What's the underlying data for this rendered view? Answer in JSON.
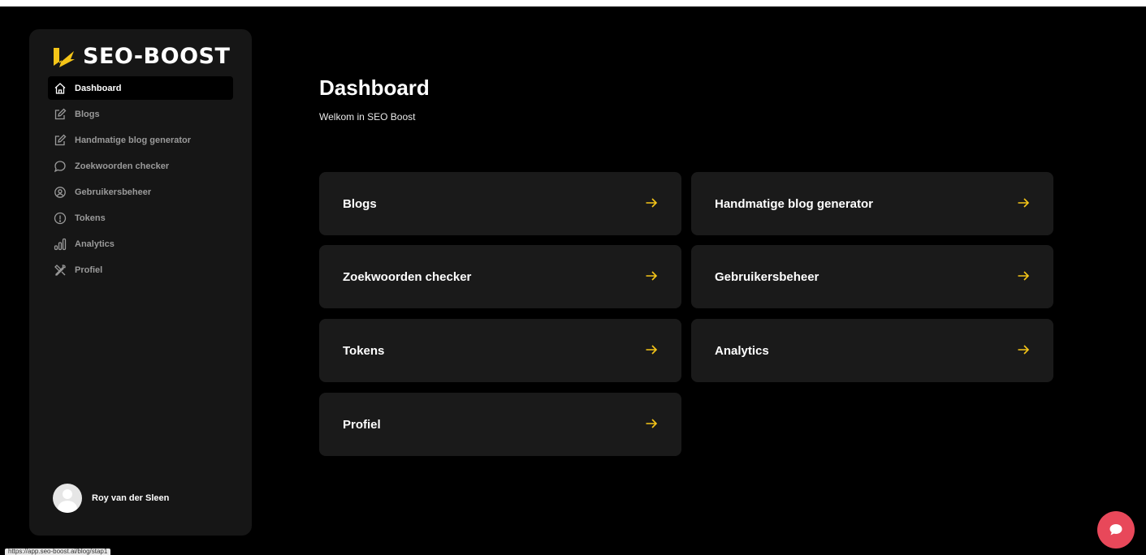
{
  "app": {
    "logo_text": "SEO-BOOST"
  },
  "sidebar": {
    "items": [
      {
        "label": "Dashboard",
        "icon": "home-icon",
        "active": true
      },
      {
        "label": "Blogs",
        "icon": "edit-icon",
        "active": false
      },
      {
        "label": "Handmatige blog generator",
        "icon": "edit-icon",
        "active": false
      },
      {
        "label": "Zoekwoorden checker",
        "icon": "chat-bubble-icon",
        "active": false
      },
      {
        "label": "Gebruikersbeheer",
        "icon": "user-circle-icon",
        "active": false
      },
      {
        "label": "Tokens",
        "icon": "info-circle-icon",
        "active": false
      },
      {
        "label": "Analytics",
        "icon": "bar-chart-icon",
        "active": false
      },
      {
        "label": "Profiel",
        "icon": "tools-icon",
        "active": false
      }
    ],
    "user": {
      "name": "Roy van der Sleen"
    }
  },
  "main": {
    "title": "Dashboard",
    "subtitle": "Welkom in SEO Boost",
    "cards": [
      {
        "label": "Blogs",
        "icon": "arrow-right-icon"
      },
      {
        "label": "Handmatige blog generator",
        "icon": "arrow-right-icon"
      },
      {
        "label": "Zoekwoorden checker",
        "icon": "arrow-right-icon"
      },
      {
        "label": "Gebruikersbeheer",
        "icon": "arrow-right-icon"
      },
      {
        "label": "Tokens",
        "icon": "arrow-right-icon"
      },
      {
        "label": "Analytics",
        "icon": "arrow-right-icon"
      },
      {
        "label": "Profiel",
        "icon": "arrow-right-icon"
      }
    ]
  },
  "status_bar": {
    "url": "https://app.seo-boost.ai/blog/stap1"
  },
  "colors": {
    "accent": "#f5c518",
    "background": "#000000",
    "sidebar": "#161616",
    "card": "#1a1a1a",
    "chat": "#e8485a"
  }
}
